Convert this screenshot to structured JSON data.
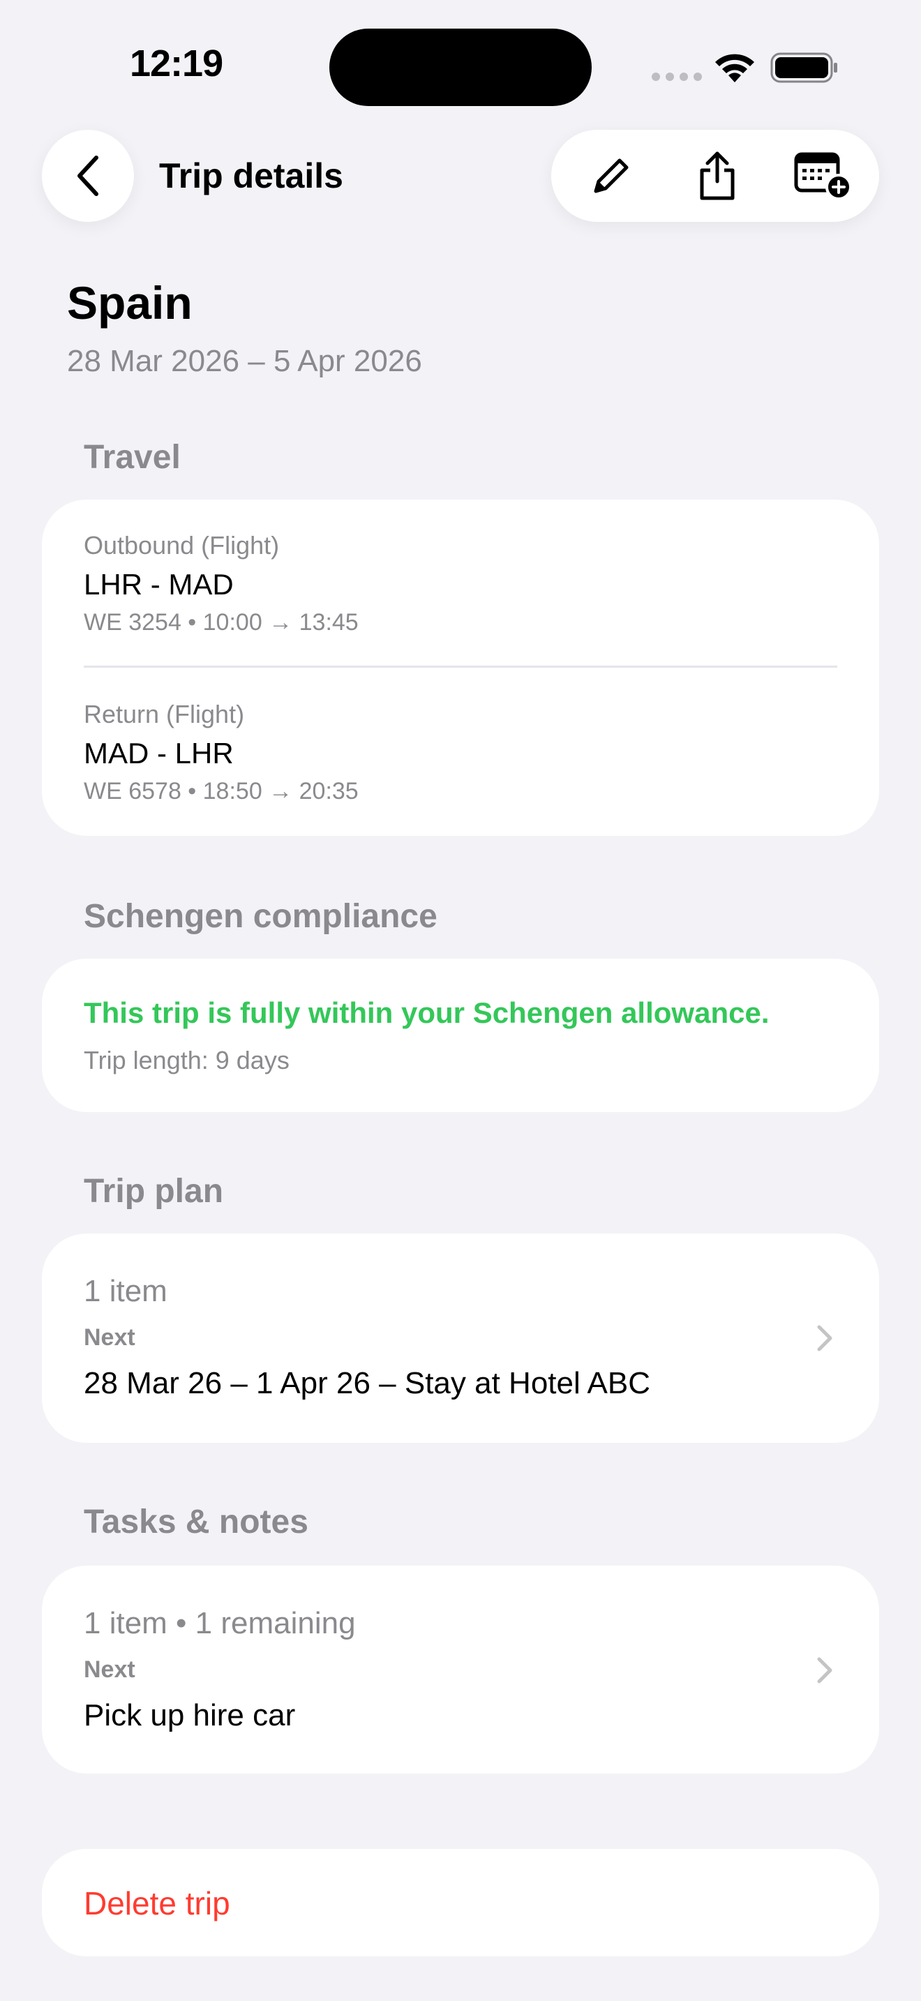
{
  "status_bar": {
    "time": "12:19"
  },
  "nav": {
    "title": "Trip details",
    "back_icon": "chevron-left-icon",
    "actions": [
      {
        "icon": "pencil-icon",
        "label": "Edit"
      },
      {
        "icon": "share-icon",
        "label": "Share"
      },
      {
        "icon": "calendar-add-icon",
        "label": "Add to calendar"
      }
    ]
  },
  "trip": {
    "title": "Spain",
    "dates": "28 Mar 2026 – 5 Apr 2026"
  },
  "travel": {
    "header": "Travel",
    "legs": [
      {
        "label": "Outbound (Flight)",
        "route": "LHR - MAD",
        "detail": "WE 3254 • 10:00 → 13:45"
      },
      {
        "label": "Return (Flight)",
        "route": "MAD - LHR",
        "detail": "WE 6578 • 18:50 → 20:35"
      }
    ]
  },
  "schengen": {
    "header": "Schengen compliance",
    "status": "This trip is fully within your Schengen allowance.",
    "length": "Trip length: 9 days",
    "status_color": "#34C759"
  },
  "trip_plan": {
    "header": "Trip plan",
    "count": "1 item",
    "next_label": "Next",
    "next_text": "28 Mar 26 – 1 Apr 26 – Stay at Hotel ABC"
  },
  "tasks": {
    "header": "Tasks & notes",
    "count": "1 item • 1 remaining",
    "next_label": "Next",
    "next_text": "Pick up hire car"
  },
  "delete": {
    "label": "Delete trip",
    "color": "#FF3B30"
  }
}
